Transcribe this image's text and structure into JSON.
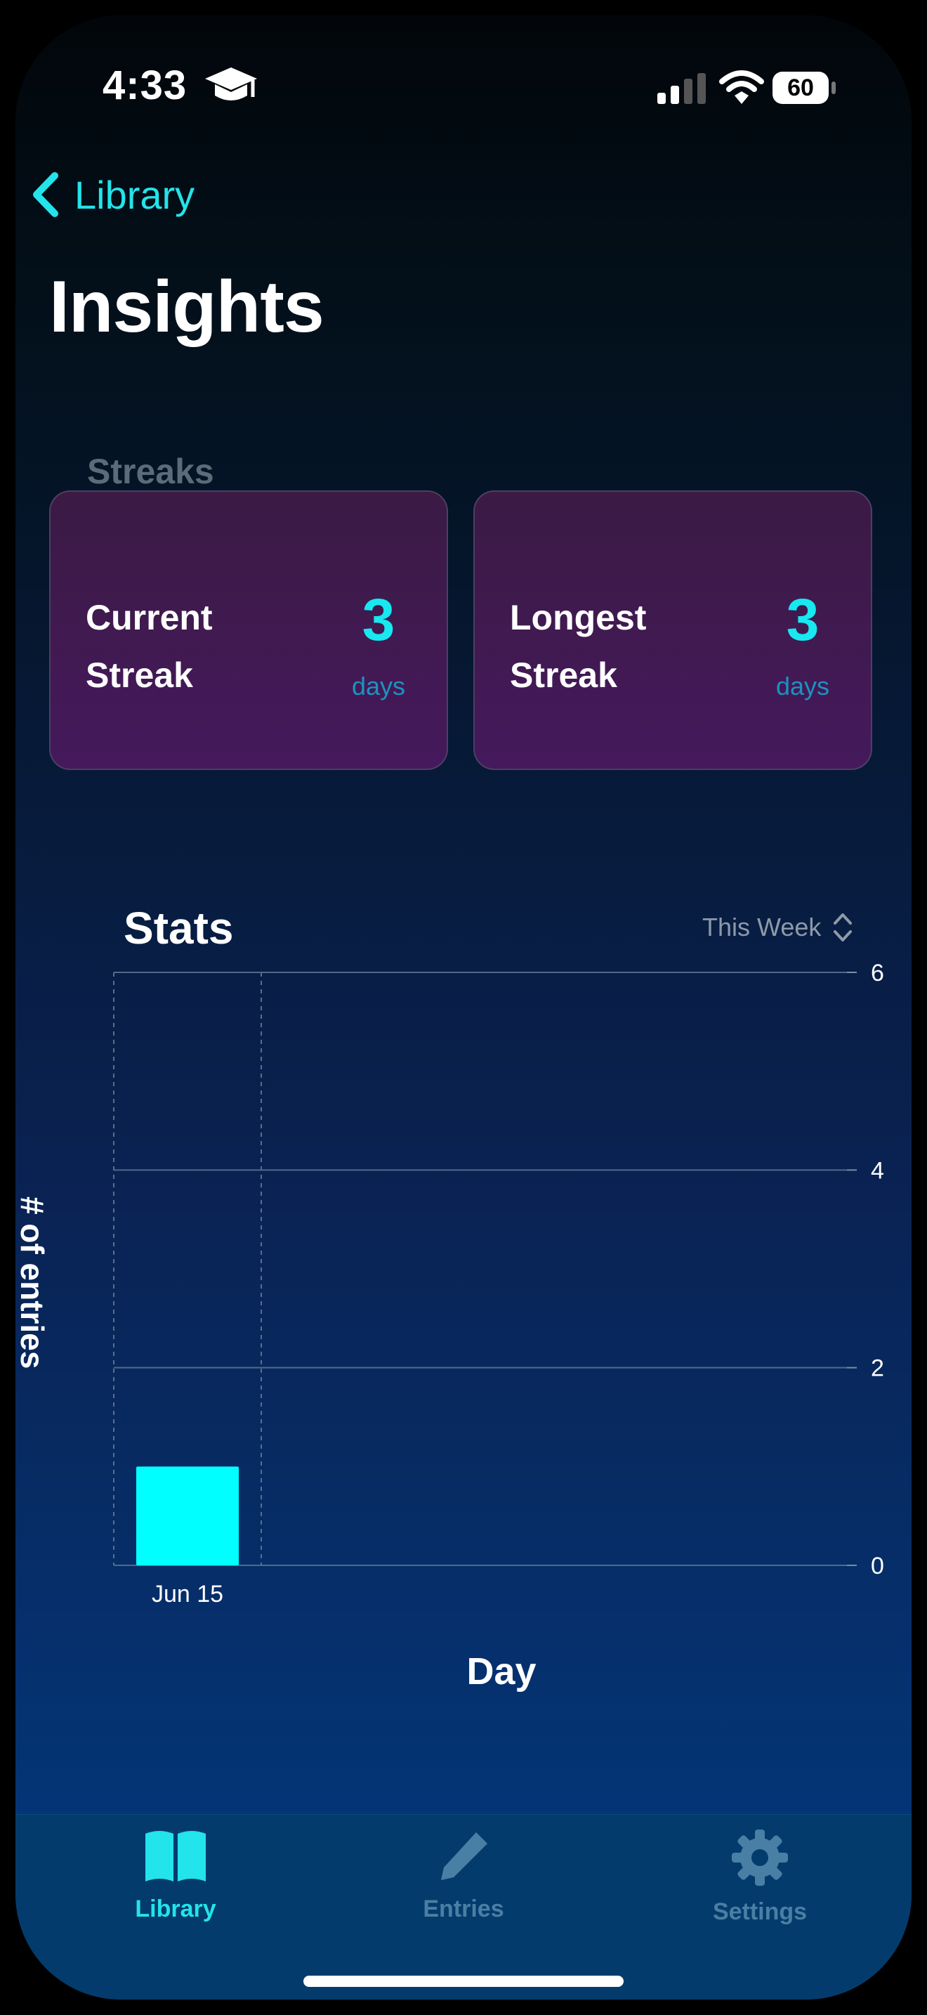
{
  "status_bar": {
    "time": "4:33",
    "battery": "60"
  },
  "nav": {
    "back_label": "Library"
  },
  "page": {
    "title": "Insights"
  },
  "streaks": {
    "section_title": "Streaks",
    "cards": [
      {
        "label_line1": "Current",
        "label_line2": "Streak",
        "value": "3",
        "unit": "days"
      },
      {
        "label_line1": "Longest",
        "label_line2": "Streak",
        "value": "3",
        "unit": "days"
      }
    ]
  },
  "stats": {
    "title": "Stats",
    "range_label": "This Week"
  },
  "chart_data": {
    "type": "bar",
    "categories": [
      "Jun 15"
    ],
    "values": [
      1
    ],
    "xlabel": "Day",
    "ylabel": "# of entries",
    "ylim": [
      0,
      6
    ],
    "yticks": [
      "0",
      "2",
      "4",
      "6"
    ],
    "grid": true,
    "y_axis_side": "right",
    "bar_color": "#00ffff"
  },
  "tab_bar": {
    "tabs": [
      {
        "label": "Library",
        "icon": "book-icon",
        "active": true
      },
      {
        "label": "Entries",
        "icon": "pencil-icon",
        "active": false
      },
      {
        "label": "Settings",
        "icon": "gear-icon",
        "active": false
      }
    ]
  },
  "colors": {
    "accent": "#22e4ea",
    "inactive_tab": "#4a7fa5",
    "card_bg": "#45195c"
  }
}
